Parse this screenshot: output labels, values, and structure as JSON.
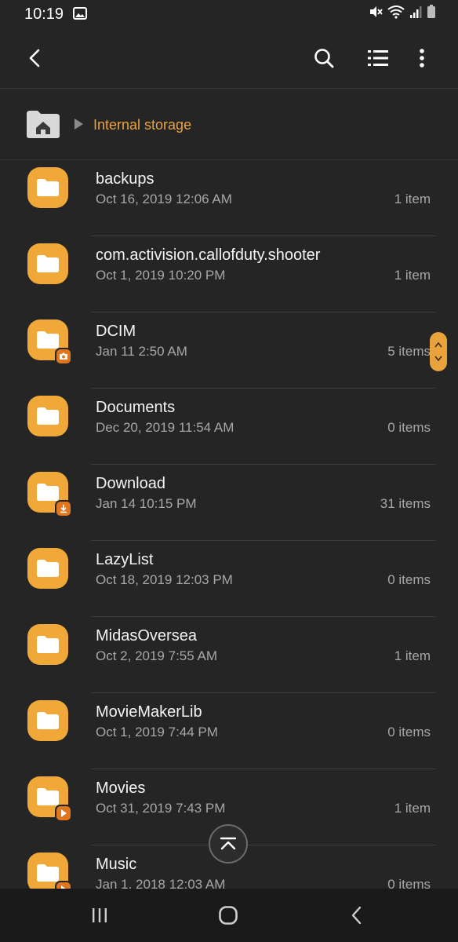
{
  "status": {
    "time": "10:19",
    "icons": [
      "image-icon",
      "mute-icon",
      "wifi-icon",
      "signal-icon",
      "battery-icon"
    ]
  },
  "toolbar": {
    "back_icon": "back-arrow-icon",
    "search_icon": "search-icon",
    "list_view_icon": "list-view-icon",
    "more_icon": "more-vert-icon"
  },
  "breadcrumb": {
    "home_icon": "home-icon",
    "path": [
      "Internal storage"
    ]
  },
  "colors": {
    "accent": "#e8a33d",
    "folder": "#f0a839",
    "badge": "#e0771e",
    "background": "#252525"
  },
  "files": [
    {
      "name": "backups",
      "date": "Oct 16, 2019 12:06 AM",
      "count": "1 item",
      "badge": null
    },
    {
      "name": "com.activision.callofduty.shooter",
      "date": "Oct 1, 2019 10:20 PM",
      "count": "1 item",
      "badge": null
    },
    {
      "name": "DCIM",
      "date": "Jan 11 2:50 AM",
      "count": "5 items",
      "badge": "camera-icon"
    },
    {
      "name": "Documents",
      "date": "Dec 20, 2019 11:54 AM",
      "count": "0 items",
      "badge": null
    },
    {
      "name": "Download",
      "date": "Jan 14 10:15 PM",
      "count": "31 items",
      "badge": "download-icon"
    },
    {
      "name": "LazyList",
      "date": "Oct 18, 2019 12:03 PM",
      "count": "0 items",
      "badge": null
    },
    {
      "name": "MidasOversea",
      "date": "Oct 2, 2019 7:55 AM",
      "count": "1 item",
      "badge": null
    },
    {
      "name": "MovieMakerLib",
      "date": "Oct 1, 2019 7:44 PM",
      "count": "0 items",
      "badge": null
    },
    {
      "name": "Movies",
      "date": "Oct 31, 2019 7:43 PM",
      "count": "1 item",
      "badge": "play-icon"
    },
    {
      "name": "Music",
      "date": "Jan 1, 2018 12:03 AM",
      "count": "0 items",
      "badge": "music-icon"
    }
  ],
  "nav": {
    "recents_icon": "recents-icon",
    "home_icon": "home-circle-icon",
    "back_icon": "back-chevron-icon"
  }
}
